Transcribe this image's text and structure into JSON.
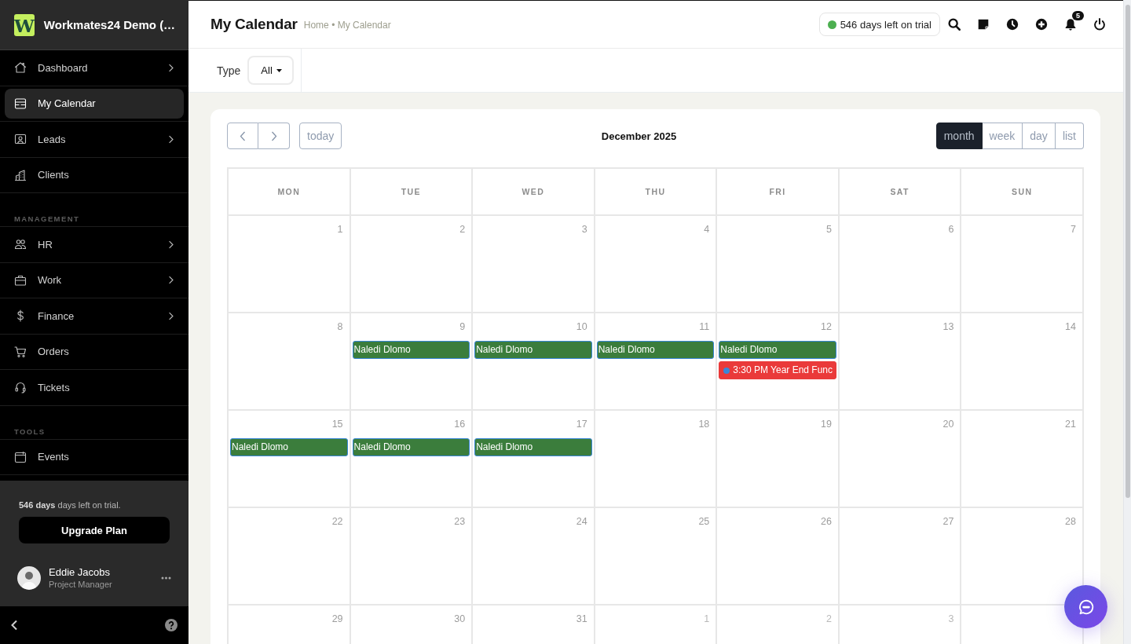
{
  "sidebar": {
    "logo": "W",
    "brand": "Workmates24 Demo (…",
    "nav": [
      {
        "kind": "item",
        "label": "Dashboard",
        "submenu": true,
        "selected": false
      },
      {
        "kind": "item",
        "label": "My Calendar",
        "submenu": false,
        "selected": true
      },
      {
        "kind": "item",
        "label": "Leads",
        "submenu": true,
        "selected": false
      },
      {
        "kind": "item",
        "label": "Clients",
        "submenu": false,
        "selected": false
      },
      {
        "kind": "section",
        "label": "MANAGEMENT"
      },
      {
        "kind": "item",
        "label": "HR",
        "submenu": true,
        "selected": false
      },
      {
        "kind": "item",
        "label": "Work",
        "submenu": true,
        "selected": false
      },
      {
        "kind": "item",
        "label": "Finance",
        "submenu": true,
        "selected": false
      },
      {
        "kind": "item",
        "label": "Orders",
        "submenu": false,
        "selected": false
      },
      {
        "kind": "item",
        "label": "Tickets",
        "submenu": false,
        "selected": false
      },
      {
        "kind": "section",
        "label": "TOOLS"
      },
      {
        "kind": "item",
        "label": "Events",
        "submenu": false,
        "selected": false
      }
    ],
    "trial_note": "**546 days** days left on trial.",
    "upgrade_button": "Upgrade Plan",
    "user": {
      "name": "Eddie Jacobs",
      "role": "Project Manager"
    }
  },
  "header": {
    "title": "My Calendar",
    "breadcrumb": "Home • My Calendar",
    "trial_badge": "546 days left on trial",
    "notification_count": "5"
  },
  "filter": {
    "label": "Type",
    "value": "All"
  },
  "calendar": {
    "today_button": "today",
    "title": "December 2025",
    "views": [
      {
        "label": "month",
        "selected": true
      },
      {
        "label": "week",
        "selected": false
      },
      {
        "label": "day",
        "selected": false
      },
      {
        "label": "list",
        "selected": false
      }
    ],
    "weekdays": [
      "MON",
      "TUE",
      "WED",
      "THU",
      "FRI",
      "SAT",
      "SUN"
    ],
    "weeks": [
      [
        {
          "day": "1",
          "other_month": false
        },
        {
          "day": "2",
          "other_month": false
        },
        {
          "day": "3",
          "other_month": false
        },
        {
          "day": "4",
          "other_month": false
        },
        {
          "day": "5",
          "other_month": false
        },
        {
          "day": "6",
          "other_month": false
        },
        {
          "day": "7",
          "other_month": false
        }
      ],
      [
        {
          "day": "8",
          "other_month": false
        },
        {
          "day": "9",
          "other_month": false,
          "events": [
            {
              "kind": "allday",
              "text": "Naledi Dlomo",
              "color": "#3b7d3c"
            }
          ]
        },
        {
          "day": "10",
          "other_month": false,
          "events": [
            {
              "kind": "allday",
              "text": "Naledi Dlomo",
              "color": "#3b7d3c"
            }
          ]
        },
        {
          "day": "11",
          "other_month": false,
          "events": [
            {
              "kind": "allday",
              "text": "Naledi Dlomo",
              "color": "#3b7d3c"
            }
          ]
        },
        {
          "day": "12",
          "other_month": false,
          "events": [
            {
              "kind": "allday",
              "text": "Naledi Dlomo",
              "color": "#3b7d3c"
            },
            {
              "kind": "timed",
              "text": "3:30 PM Year End Func",
              "color": "#ea3a3a"
            }
          ]
        },
        {
          "day": "13",
          "other_month": false
        },
        {
          "day": "14",
          "other_month": false
        }
      ],
      [
        {
          "day": "15",
          "other_month": false,
          "events": [
            {
              "kind": "allday",
              "text": "Naledi Dlomo",
              "color": "#3b7d3c"
            }
          ]
        },
        {
          "day": "16",
          "other_month": false,
          "events": [
            {
              "kind": "allday",
              "text": "Naledi Dlomo",
              "color": "#3b7d3c"
            }
          ]
        },
        {
          "day": "17",
          "other_month": false,
          "events": [
            {
              "kind": "allday",
              "text": "Naledi Dlomo",
              "color": "#3b7d3c"
            }
          ]
        },
        {
          "day": "18",
          "other_month": false
        },
        {
          "day": "19",
          "other_month": false
        },
        {
          "day": "20",
          "other_month": false
        },
        {
          "day": "21",
          "other_month": false
        }
      ],
      [
        {
          "day": "22",
          "other_month": false
        },
        {
          "day": "23",
          "other_month": false
        },
        {
          "day": "24",
          "other_month": false
        },
        {
          "day": "25",
          "other_month": false
        },
        {
          "day": "26",
          "other_month": false
        },
        {
          "day": "27",
          "other_month": false
        },
        {
          "day": "28",
          "other_month": false
        }
      ],
      [
        {
          "day": "29",
          "other_month": false
        },
        {
          "day": "30",
          "other_month": false
        },
        {
          "day": "31",
          "other_month": false
        },
        {
          "day": "1",
          "other_month": true
        },
        {
          "day": "2",
          "other_month": true
        },
        {
          "day": "3",
          "other_month": true
        }
      ]
    ]
  }
}
